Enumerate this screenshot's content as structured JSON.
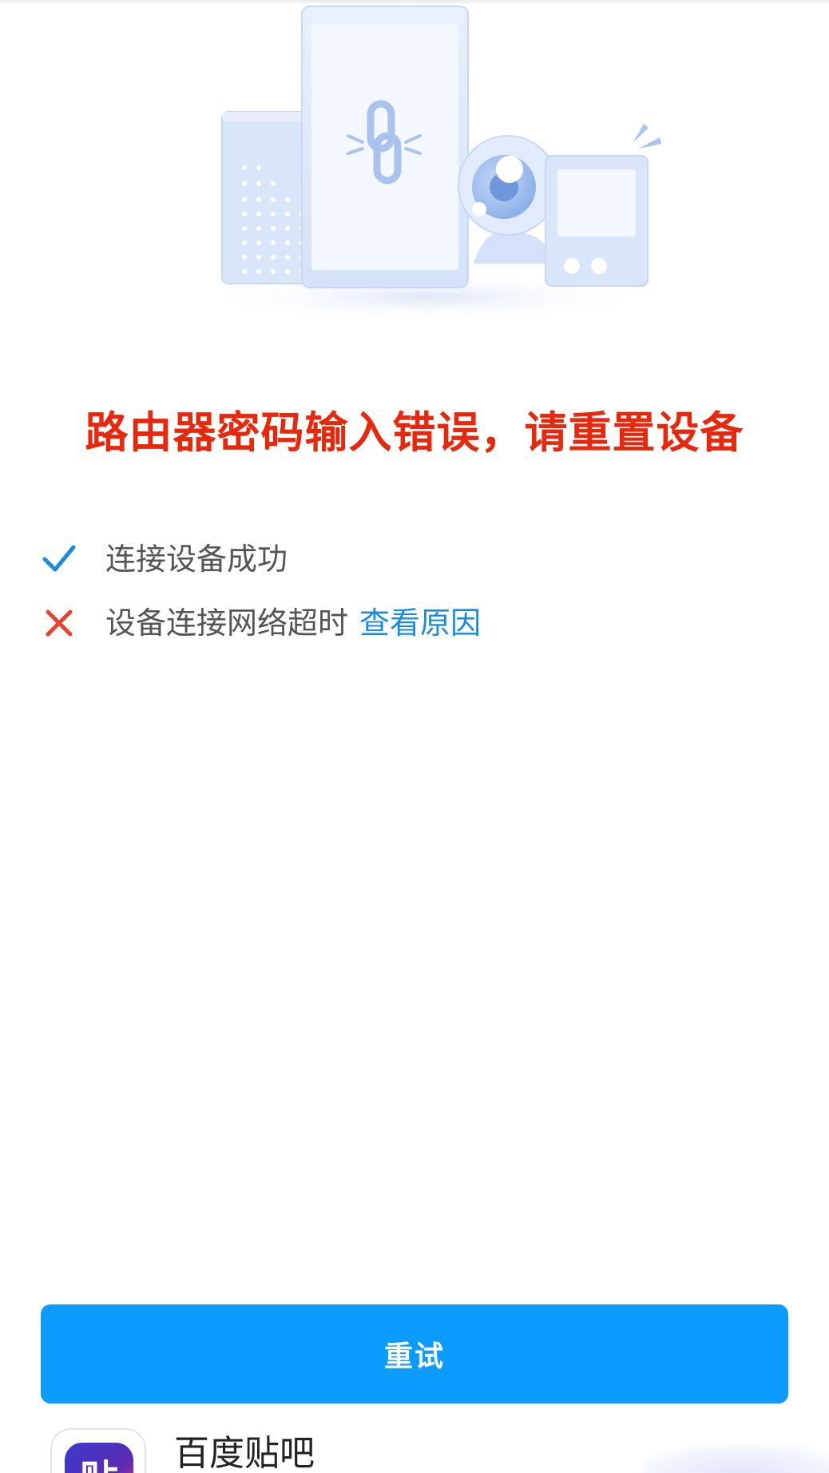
{
  "error": {
    "title": "路由器密码输入错误，请重置设备"
  },
  "status_items": [
    {
      "state": "success",
      "icon": "check-icon",
      "label": "连接设备成功",
      "color": "#1a8ce0"
    },
    {
      "state": "failed",
      "icon": "cross-icon",
      "label": "设备连接网络超时",
      "link_label": "查看原因",
      "color": "#e8432c"
    }
  ],
  "actions": {
    "retry_label": "重试"
  },
  "app_banner": {
    "icon": "tieba-app-icon",
    "icon_glyph": "贴",
    "name": "百度贴吧"
  },
  "colors": {
    "error": "#e8280c",
    "accent": "#0c9bff",
    "link": "#1a8ce0",
    "success": "#1a8ce0",
    "failure": "#e8432c"
  }
}
